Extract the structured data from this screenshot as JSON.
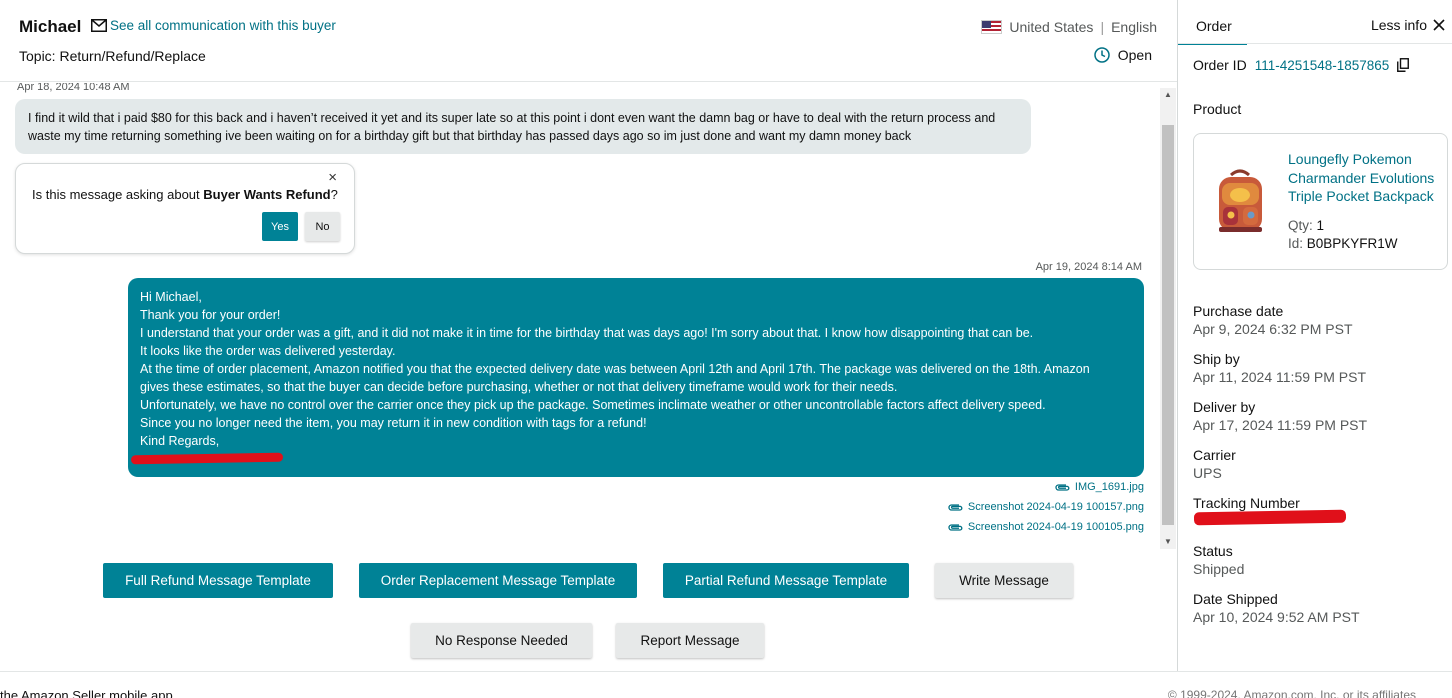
{
  "header": {
    "buyer_name": "Michael",
    "communication_link": "See all communication with this buyer",
    "topic": "Topic: Return/Refund/Replace",
    "country": "United States",
    "separator": "|",
    "language": "English",
    "status": "Open"
  },
  "messages": {
    "incoming_timestamp": "Apr 18, 2024 10:48 AM",
    "incoming_text": "I find it wild that i paid $80 for this back and i haven’t received it yet and its super late so at this point i dont even want the damn bag or have to deal with the return process and waste my time returning something ive been waiting on for a birthday gift but that birthday has passed days ago so im just done and want my damn money back",
    "intent_prompt": {
      "question_prefix": "Is this message asking about ",
      "intent": "Buyer Wants Refund",
      "question_suffix": "?",
      "close": "×",
      "yes_label": "Yes",
      "no_label": "No"
    },
    "outgoing_timestamp": "Apr 19, 2024 8:14 AM",
    "outgoing_lines": [
      "Hi Michael,",
      "Thank you for your order!",
      "I understand that your order was a gift, and it did not make it in time for the birthday that was days ago! I'm sorry about that. I know how disappointing that can be.",
      "It looks like the order was delivered yesterday.",
      "At the time of order placement, Amazon notified you that the expected delivery date was between April 12th and April 17th. The package was delivered on the 18th. Amazon",
      "gives these estimates, so that the buyer can decide before purchasing, whether or not that delivery timeframe would work for their needs.",
      "Unfortunately, we have no control over the carrier once they pick up the package. Sometimes inclimate weather or other uncontrollable factors affect delivery speed.",
      "Since you no longer need the item, you may return it in new condition with tags for a refund!",
      "Kind Regards,"
    ],
    "attachments": [
      "IMG_1691.jpg",
      "Screenshot 2024-04-19 100157.png",
      "Screenshot 2024-04-19 100105.png"
    ]
  },
  "actions": {
    "full_refund": "Full Refund Message Template",
    "order_replacement": "Order Replacement Message Template",
    "partial_refund": "Partial Refund Message Template",
    "write_message": "Write Message",
    "no_response": "No Response Needed",
    "report": "Report Message"
  },
  "footer": {
    "left": "the Amazon Seller mobile app",
    "right": "© 1999-2024, Amazon.com, Inc. or its affiliates"
  },
  "side_panel": {
    "tab": "Order",
    "less_info": "Less info",
    "order_id_label": "Order ID",
    "order_id": "111-4251548-1857865",
    "product_label": "Product",
    "product": {
      "title": "Loungefly Pokemon Charmander Evolutions Triple Pocket Backpack",
      "qty_label": "Qty: ",
      "qty": "1",
      "id_label": "Id: ",
      "id": "B0BPKYFR1W"
    },
    "fields": [
      {
        "label": "Purchase date",
        "value": "Apr 9, 2024 6:32 PM PST"
      },
      {
        "label": "Ship by",
        "value": "Apr 11, 2024 11:59 PM PST"
      },
      {
        "label": "Deliver by",
        "value": "Apr 17, 2024 11:59 PM PST"
      },
      {
        "label": "Carrier",
        "value": "UPS"
      },
      {
        "label": "Tracking Number",
        "value": ""
      },
      {
        "label": "Status",
        "value": "Shipped"
      },
      {
        "label": "Date Shipped",
        "value": "Apr 10, 2024 9:52 AM PST"
      }
    ]
  },
  "colors": {
    "teal": "#008296",
    "link": "#007185",
    "incoming_bubble": "#e3e9ea",
    "redaction": "#e0101a"
  }
}
